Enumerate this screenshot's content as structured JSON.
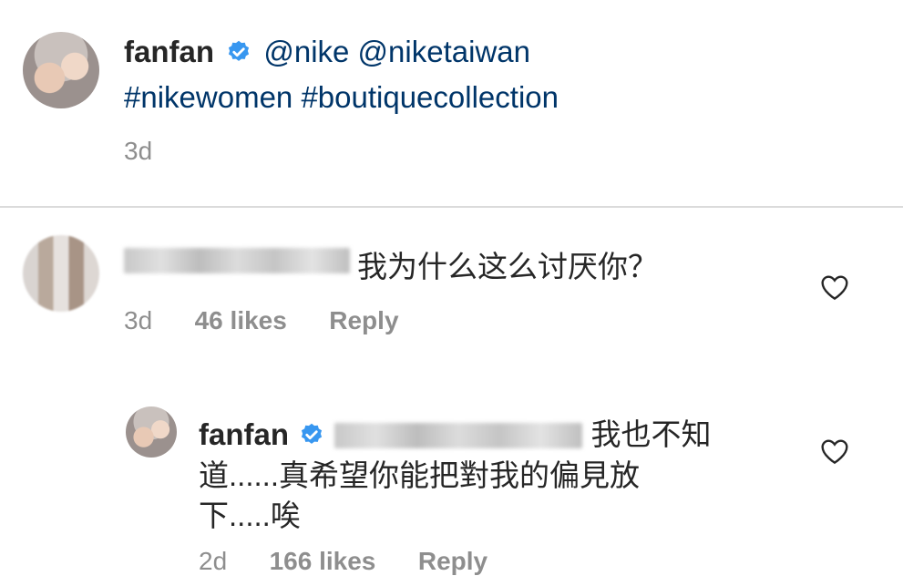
{
  "post": {
    "username": "fanfan",
    "mentions": "@nike @niketaiwan",
    "hashtags": "#nikewomen #boutiquecollection",
    "time": "3d"
  },
  "comment": {
    "text": "我为什么这么讨厌你？",
    "time": "3d",
    "likes": "46 likes",
    "reply_label": "Reply"
  },
  "reply": {
    "username": "fanfan",
    "line1": "我也不知",
    "line2": "道......真希望你能把對我的偏見放",
    "line3": "下.....唉",
    "time": "2d",
    "likes": "166 likes",
    "reply_label": "Reply"
  },
  "icons": {
    "verified": "verified-badge-icon",
    "like": "heart-icon"
  },
  "colors": {
    "verified_blue": "#3897f0",
    "link": "#003569",
    "meta_gray": "#8e8e8e"
  }
}
